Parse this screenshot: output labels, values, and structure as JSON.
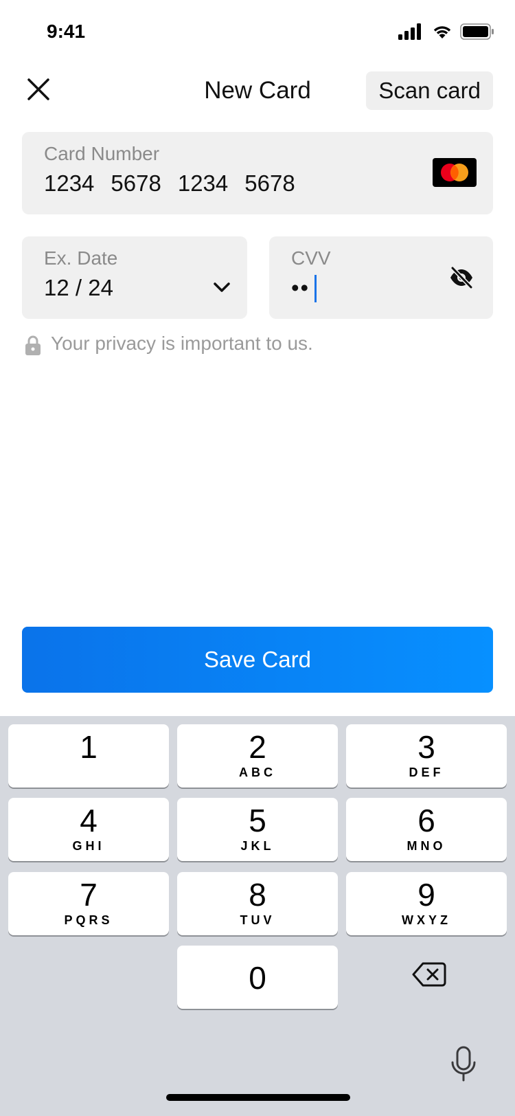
{
  "status_bar": {
    "time": "9:41"
  },
  "header": {
    "title": "New Card",
    "scan_label": "Scan card"
  },
  "card_number": {
    "label": "Card Number",
    "groups": [
      "1234",
      "5678",
      "1234",
      "5678"
    ],
    "brand_icon": "mastercard-icon"
  },
  "exp_date": {
    "label": "Ex. Date",
    "value": "12 / 24"
  },
  "cvv": {
    "label": "CVV",
    "masked": "••"
  },
  "privacy": {
    "text": "Your privacy is important to us."
  },
  "save_button": {
    "label": "Save Card"
  },
  "keyboard": {
    "keys": [
      {
        "digit": "1",
        "letters": ""
      },
      {
        "digit": "2",
        "letters": "ABC"
      },
      {
        "digit": "3",
        "letters": "DEF"
      },
      {
        "digit": "4",
        "letters": "GHI"
      },
      {
        "digit": "5",
        "letters": "JKL"
      },
      {
        "digit": "6",
        "letters": "MNO"
      },
      {
        "digit": "7",
        "letters": "PQRS"
      },
      {
        "digit": "8",
        "letters": "TUV"
      },
      {
        "digit": "9",
        "letters": "WXYZ"
      },
      {
        "digit": "0",
        "letters": ""
      }
    ]
  },
  "colors": {
    "accent": "#0A84FF",
    "field_bg": "#F0F0F0",
    "keyboard_bg": "#D5D8DE",
    "mastercard_red": "#EB001B",
    "mastercard_orange": "#F79E1B"
  }
}
